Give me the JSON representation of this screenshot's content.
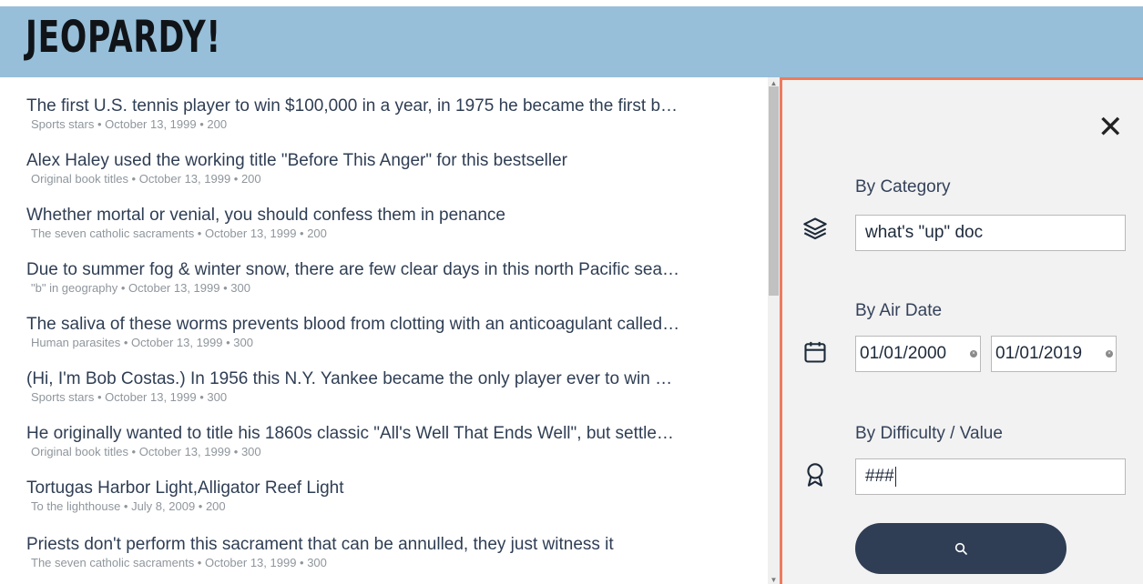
{
  "header": {
    "logo_text": "JEOPARDY!"
  },
  "results": [
    {
      "question": "The first U.S. tennis player to win $100,000 in a year, in 1975 he became the first b…",
      "meta": "Sports stars • October 13, 1999 • 200"
    },
    {
      "question": "Alex Haley used the working title \"Before This Anger\" for this bestseller",
      "meta": "Original book titles • October 13, 1999 • 200"
    },
    {
      "question": "Whether mortal or venial, you should confess them in penance",
      "meta": "The seven catholic sacraments • October 13, 1999 • 200"
    },
    {
      "question": "Due to summer fog & winter snow, there are few clear days in this north Pacific sea…",
      "meta": "\"b\" in geography • October 13, 1999 • 300"
    },
    {
      "question": "The saliva of these worms prevents blood from clotting with an anticoagulant called…",
      "meta": "Human parasites • October 13, 1999 • 300"
    },
    {
      "question": "(Hi, I'm Bob Costas.) In 1956 this N.Y. Yankee became the only player ever to win …",
      "meta": "Sports stars • October 13, 1999 • 300"
    },
    {
      "question": "He originally wanted to title his 1860s classic \"All's Well That Ends Well\", but settle…",
      "meta": "Original book titles • October 13, 1999 • 300"
    },
    {
      "question": "Tortugas Harbor Light,Alligator Reef Light",
      "meta": "To the lighthouse • July 8, 2009 • 200"
    },
    {
      "question": "Priests don't perform this sacrament that can be annulled, they just witness it",
      "meta": "The seven catholic sacraments • October 13, 1999 • 300"
    }
  ],
  "filters": {
    "close_icon": "close-icon",
    "category": {
      "label": "By Category",
      "icon": "layers-icon",
      "value": "what's \"up\" doc"
    },
    "air_date": {
      "label": "By Air Date",
      "icon": "calendar-icon",
      "from": "01/01/2000",
      "to": "01/01/2019"
    },
    "difficulty": {
      "label": "By Difficulty / Value",
      "icon": "award-icon",
      "value": "###"
    },
    "search_icon": "search-icon"
  },
  "colors": {
    "header_bg": "#97bfd9",
    "panel_border": "#ee7b5c",
    "primary": "#2f3e54"
  }
}
